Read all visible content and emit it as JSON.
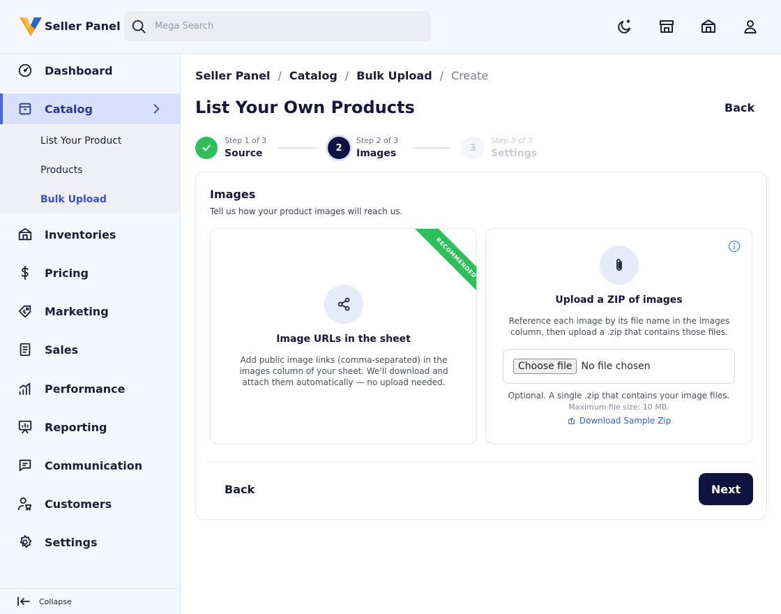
{
  "header": {
    "app_name": "Seller Panel",
    "logo_colors": {
      "primary": "#f5a623",
      "secondary": "#2f5fd0"
    },
    "search": {
      "placeholder": "Mega Search",
      "value": ""
    },
    "icons": [
      "moon-icon",
      "storefront-icon",
      "store-icon",
      "user-icon"
    ]
  },
  "sidebar": {
    "items": [
      {
        "label": "Dashboard",
        "icon": "dashboard-gauge-icon"
      },
      {
        "label": "Catalog",
        "icon": "catalog-box-icon",
        "active": true,
        "expanded": true
      },
      {
        "label": "Inventories",
        "icon": "warehouse-icon"
      },
      {
        "label": "Pricing",
        "icon": "dollar-icon"
      },
      {
        "label": "Marketing",
        "icon": "tag-icon"
      },
      {
        "label": "Sales",
        "icon": "receipt-icon"
      },
      {
        "label": "Performance",
        "icon": "bar-chart-icon"
      },
      {
        "label": "Reporting",
        "icon": "presentation-icon"
      },
      {
        "label": "Communication",
        "icon": "chat-icon"
      },
      {
        "label": "Customers",
        "icon": "customers-icon"
      },
      {
        "label": "Settings",
        "icon": "gear-icon"
      }
    ],
    "catalog_sub": [
      {
        "label": "List Your Product"
      },
      {
        "label": "Products"
      },
      {
        "label": "Bulk Upload",
        "active": true
      }
    ],
    "collapse_label": "Collapse",
    "accent": "#4b63db"
  },
  "breadcrumb": [
    "Seller Panel",
    "Catalog",
    "Bulk Upload",
    "Create"
  ],
  "page": {
    "title": "List Your Own Products",
    "back_label": "Back"
  },
  "stepper": {
    "steps": [
      {
        "small": "Step 1 of 3",
        "label": "Source",
        "state": "done",
        "number": ""
      },
      {
        "small": "Step 2 of 3",
        "label": "Images",
        "state": "current",
        "number": "2"
      },
      {
        "small": "Step 3 of 3",
        "label": "Settings",
        "state": "upcoming",
        "number": "3"
      }
    ],
    "done_color": "#2dbf5a",
    "current_color": "#0f1340"
  },
  "card": {
    "title": "Images",
    "subtitle": "Tell us how your product images will reach us.",
    "option_urls": {
      "ribbon": "RECOMMENDED",
      "title": "Image URLs in the sheet",
      "description": "Add public image links (comma-separated) in the images column of your sheet. We'll download and attach them automatically — no upload needed.",
      "icon": "share-nodes-icon"
    },
    "option_zip": {
      "title": "Upload a ZIP of images",
      "description": "Reference each image by its file name in the images column, then upload a .zip that contains those files.",
      "choose_label": "Choose file",
      "no_file": "No file chosen",
      "note": "Optional. A single .zip that contains your image files.",
      "max_size": "Maximum file size: 10 MB.",
      "download_label": "Download Sample Zip",
      "icon": "paperclip-icon"
    },
    "back_label": "Back",
    "next_label": "Next"
  }
}
